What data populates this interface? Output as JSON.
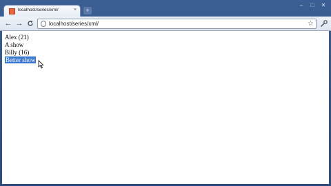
{
  "browser": {
    "tab": {
      "title": "localhost/series/xml/",
      "close_icon": "close-icon"
    },
    "new_tab_label": "+",
    "window_controls": {
      "minimize": "–",
      "maximize": "□",
      "close": "✕"
    },
    "nav": {
      "back": "←",
      "forward": "→",
      "reload": "C"
    },
    "address_bar": {
      "url": "localhost/series/xml/"
    },
    "star_glyph": "☆",
    "wrench_glyph": "🔧"
  },
  "page": {
    "lines": [
      "Alex (21)",
      "A show",
      "Billy (16)"
    ],
    "selected_line": "Better show"
  },
  "colors": {
    "selection": "#3b78d0",
    "frame": "#2b4c7e"
  }
}
